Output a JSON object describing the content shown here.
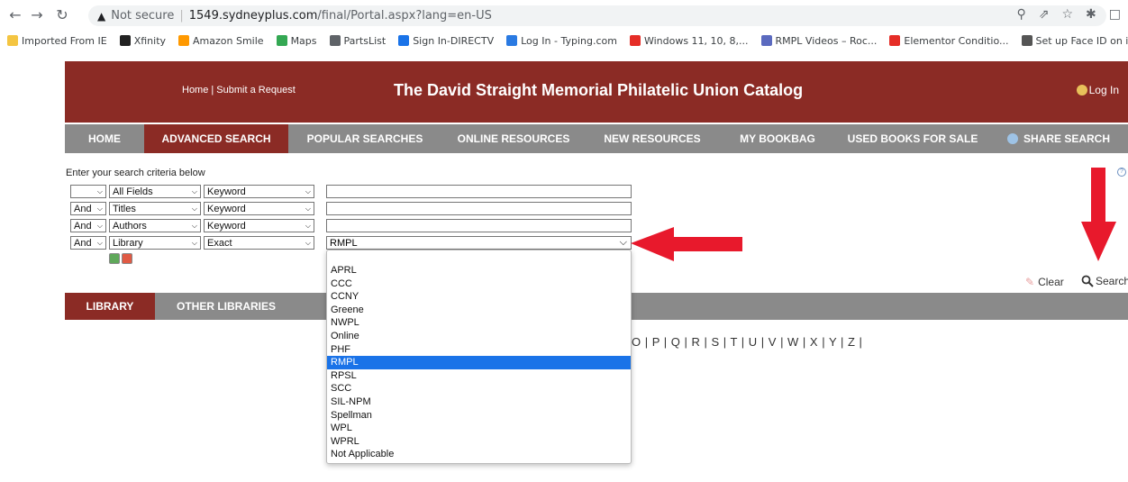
{
  "browser": {
    "url_warning": "Not secure",
    "url_host": "1549.sydneyplus.com",
    "url_path": "/final/Portal.aspx?lang=en-US",
    "bookmarks": [
      {
        "label": "Imported From IE",
        "color": "#f4c542"
      },
      {
        "label": "Xfinity",
        "color": "#222222"
      },
      {
        "label": "Amazon Smile",
        "color": "#ff9900"
      },
      {
        "label": "Maps",
        "color": "#34a853"
      },
      {
        "label": "PartsList",
        "color": "#5f6368"
      },
      {
        "label": "Sign In-DIRECTV",
        "color": "#1a73e8"
      },
      {
        "label": "Log In - Typing.com",
        "color": "#2a7ae2"
      },
      {
        "label": "Windows 11, 10, 8,...",
        "color": "#e52d27"
      },
      {
        "label": "RMPL Videos – Roc...",
        "color": "#5b6abf"
      },
      {
        "label": "Elementor Conditio...",
        "color": "#e52d27"
      },
      {
        "label": "Set up Face ID on i...",
        "color": "#555555"
      }
    ]
  },
  "header": {
    "links": "Home | Submit a Request",
    "title": "The David Straight Memorial Philatelic Union Catalog",
    "login": "Log In"
  },
  "nav": {
    "items": [
      "HOME",
      "ADVANCED SEARCH",
      "POPULAR SEARCHES",
      "ONLINE RESOURCES",
      "NEW RESOURCES",
      "MY BOOKBAG",
      "USED BOOKS FOR SALE",
      "SHARE SEARCH"
    ],
    "active": "ADVANCED SEARCH"
  },
  "search": {
    "instructions": "Enter your search criteria below",
    "rows": [
      {
        "op": "",
        "field": "All Fields",
        "mode": "Keyword",
        "value": ""
      },
      {
        "op": "And",
        "field": "Titles",
        "mode": "Keyword",
        "value": ""
      },
      {
        "op": "And",
        "field": "Authors",
        "mode": "Keyword",
        "value": ""
      },
      {
        "op": "And",
        "field": "Library",
        "mode": "Exact",
        "value": "RMPL"
      }
    ],
    "clear_label": "Clear",
    "search_label": "Search"
  },
  "library_tabs": [
    "LIBRARY",
    "OTHER LIBRARIES"
  ],
  "alphabet": "O | P | Q | R | S | T | U | V | W | X | Y | Z |",
  "dropdown": {
    "options": [
      "APRL",
      "CCC",
      "CCNY",
      "Greene",
      "NWPL",
      "Online",
      "PHF",
      "RMPL",
      "RPSL",
      "SCC",
      "SIL-NPM",
      "Spellman",
      "WPL",
      "WPRL",
      "Not Applicable"
    ],
    "selected": "RMPL"
  },
  "colors": {
    "brand": "#8b2b25",
    "nav_bg": "#8a8a8a",
    "selected_option": "#1a73e8",
    "annotation": "#e8192c"
  }
}
